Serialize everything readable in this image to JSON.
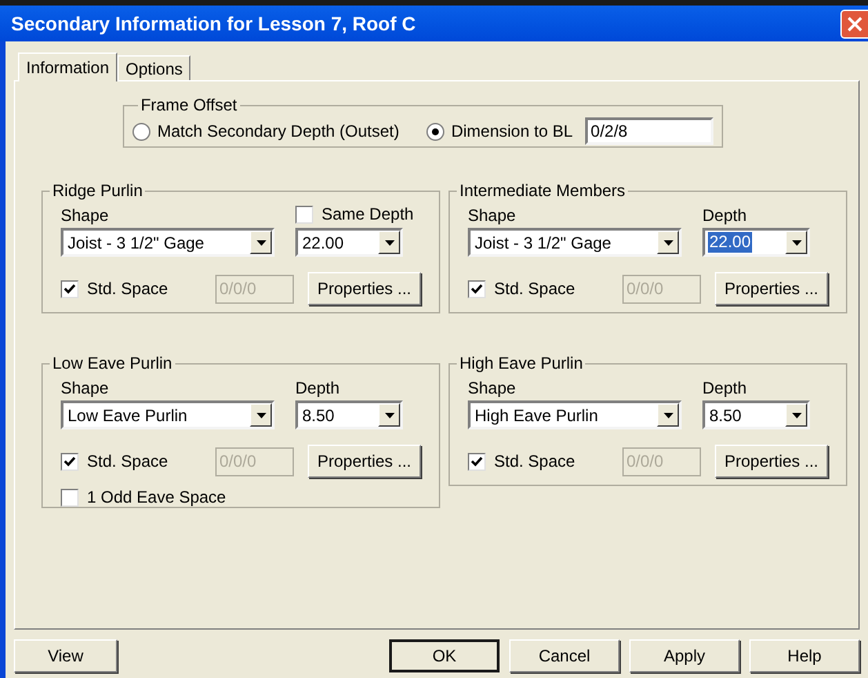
{
  "window": {
    "title": "Secondary Information for Lesson 7, Roof C"
  },
  "tabs": [
    {
      "label": "Information",
      "selected": true
    },
    {
      "label": "Options",
      "selected": false
    }
  ],
  "frame_offset": {
    "title": "Frame Offset",
    "options": [
      {
        "label": "Match Secondary Depth (Outset)",
        "selected": false
      },
      {
        "label": "Dimension to BL",
        "selected": true
      }
    ],
    "value": "0/2/8"
  },
  "groups": [
    {
      "title": "Ridge Purlin",
      "shape_label": "Shape",
      "shape": "Joist - 3 1/2\" Gage",
      "depth_header": {
        "kind": "checkbox",
        "label": "Same Depth",
        "checked": false
      },
      "depth": "22.00",
      "depth_selected": false,
      "std_space": {
        "label": "Std. Space",
        "checked": true,
        "value": "0/0/0",
        "disabled": true
      },
      "properties": "Properties ..."
    },
    {
      "title": "Intermediate Members",
      "shape_label": "Shape",
      "shape": "Joist - 3 1/2\" Gage",
      "depth_header": {
        "kind": "label",
        "label": "Depth"
      },
      "depth": "22.00",
      "depth_selected": true,
      "std_space": {
        "label": "Std. Space",
        "checked": true,
        "value": "0/0/0",
        "disabled": true
      },
      "properties": "Properties ..."
    },
    {
      "title": "Low Eave Purlin",
      "shape_label": "Shape",
      "shape": "Low Eave Purlin",
      "depth_header": {
        "kind": "label",
        "label": "Depth"
      },
      "depth": "8.50",
      "depth_selected": false,
      "std_space": {
        "label": "Std. Space",
        "checked": true,
        "value": "0/0/0",
        "disabled": true
      },
      "properties": "Properties ...",
      "extra": {
        "label": "1 Odd Eave Space",
        "checked": false
      }
    },
    {
      "title": "High Eave Purlin",
      "shape_label": "Shape",
      "shape": "High Eave Purlin",
      "depth_header": {
        "kind": "label",
        "label": "Depth"
      },
      "depth": "8.50",
      "depth_selected": false,
      "std_space": {
        "label": "Std. Space",
        "checked": true,
        "value": "0/0/0",
        "disabled": true
      },
      "properties": "Properties ..."
    }
  ],
  "buttons": [
    {
      "label": "View",
      "default": false
    },
    {
      "label": "OK",
      "default": true
    },
    {
      "label": "Cancel",
      "default": false
    },
    {
      "label": "Apply",
      "default": false
    },
    {
      "label": "Help",
      "default": false
    }
  ]
}
